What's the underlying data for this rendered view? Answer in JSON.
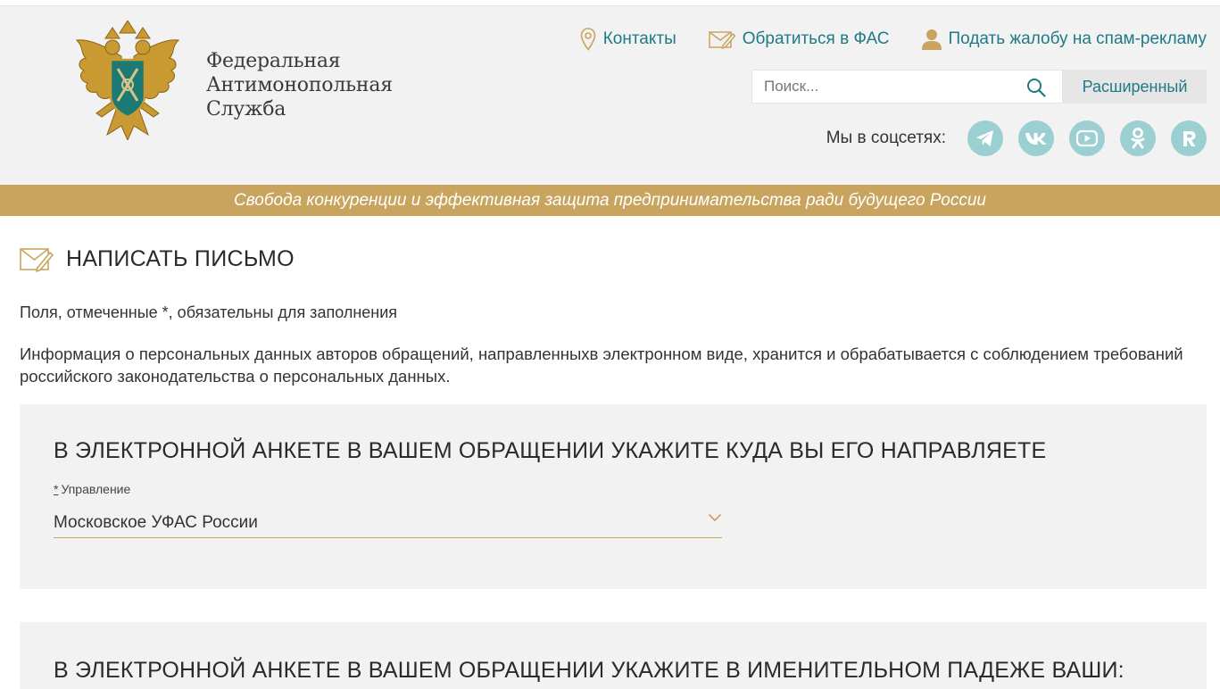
{
  "brand": {
    "line1": "Федеральная",
    "line2": "Антимонопольная",
    "line3": "Служба"
  },
  "header_links": {
    "contacts": "Контакты",
    "appeal": "Обратиться в ФАС",
    "spam": "Подать жалобу на спам-рекламу"
  },
  "search": {
    "placeholder": "Поиск...",
    "advanced_label": "Расширенный"
  },
  "social": {
    "label": "Мы в соцсетях:",
    "icons": [
      "telegram-icon",
      "vk-icon",
      "youtube-icon",
      "odnoklassniki-icon",
      "rutube-icon"
    ]
  },
  "slogan": "Свобода конкуренции и эффективная защита предпринимательства ради будущего России",
  "page": {
    "title": "НАПИСАТЬ ПИСЬМО",
    "required_note": "Поля, отмеченные *, обязательны для заполнения",
    "info": "Информация о персональных данных авторов обращений, направленныхв электронном виде, хранится и обрабатывается с соблюдением требований российского законодательства о персональных данных."
  },
  "section1": {
    "heading": "В ЭЛЕКТРОННОЙ АНКЕТЕ В ВАШЕМ ОБРАЩЕНИИ УКАЖИТЕ КУДА ВЫ ЕГО НАПРАВЛЯЕТЕ",
    "field_required_mark": "*",
    "field_label": "Управление",
    "field_value": "Московское УФАС России"
  },
  "section2": {
    "heading": "В ЭЛЕКТРОННОЙ АНКЕТЕ В ВАШЕМ ОБРАЩЕНИИ УКАЖИТЕ В ИМЕНИТЕЛЬНОМ ПАДЕЖЕ ВАШИ:"
  },
  "colors": {
    "accent_gold": "#c9a45e",
    "link_teal": "#1e7a86",
    "social_circle": "#9ccfd1",
    "header_bg": "#f2f2f2"
  }
}
